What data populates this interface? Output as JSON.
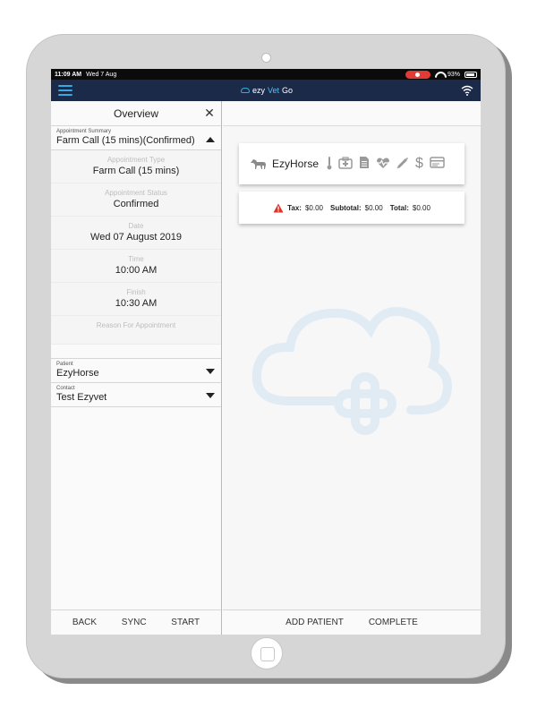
{
  "status_bar": {
    "time": "11:09 AM",
    "date": "Wed 7 Aug",
    "battery": "93%"
  },
  "app_bar": {
    "logo_prefix": "ezy",
    "logo_vet": "Vet",
    "logo_suffix": "Go"
  },
  "overview": {
    "title": "Overview",
    "summary_label": "Appointment Summary",
    "summary_value": "Farm Call (15 mins)(Confirmed)",
    "details": [
      {
        "label": "Appointment Type",
        "value": "Farm Call (15 mins)"
      },
      {
        "label": "Appointment Status",
        "value": "Confirmed"
      },
      {
        "label": "Date",
        "value": "Wed 07 August 2019"
      },
      {
        "label": "Time",
        "value": "10:00 AM"
      },
      {
        "label": "Finish",
        "value": "10:30 AM"
      },
      {
        "label": "Reason For Appointment",
        "value": ""
      }
    ],
    "patient_label": "Patient",
    "patient_value": "EzyHorse",
    "contact_label": "Contact",
    "contact_value": "Test Ezyvet"
  },
  "left_footer": {
    "back": "BACK",
    "sync": "SYNC",
    "start": "START"
  },
  "patient_card": {
    "name": "EzyHorse",
    "icons": [
      "horse-icon",
      "thermometer-icon",
      "medical-kit-icon",
      "document-icon",
      "heart-rate-icon",
      "syringe-icon",
      "dollar-icon",
      "card-icon"
    ]
  },
  "totals": {
    "tax_label": "Tax:",
    "tax_value": "$0.00",
    "subtotal_label": "Subtotal:",
    "subtotal_value": "$0.00",
    "total_label": "Total:",
    "total_value": "$0.00"
  },
  "right_footer": {
    "add_patient": "ADD PATIENT",
    "complete": "COMPLETE"
  },
  "colors": {
    "app_bar": "#1c2a4a",
    "accent": "#3aa7e0",
    "warning": "#d9352b"
  }
}
